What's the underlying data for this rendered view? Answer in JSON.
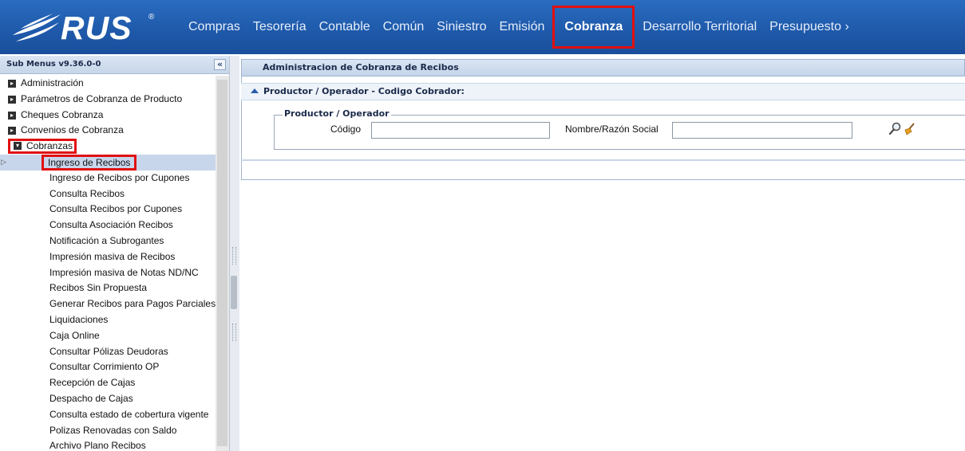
{
  "header": {
    "logo_text": "RUS",
    "logo_mark": "®",
    "nav": [
      {
        "label": "Compras"
      },
      {
        "label": "Tesorería"
      },
      {
        "label": "Contable"
      },
      {
        "label": "Común"
      },
      {
        "label": "Siniestro"
      },
      {
        "label": "Emisión"
      },
      {
        "label": "Cobranza"
      },
      {
        "label": "Desarrollo Territorial"
      },
      {
        "label": "Presupuesto ›"
      }
    ],
    "active_nav": "Cobranza"
  },
  "sidebar": {
    "title": "Sub Menus v9.36.0-0",
    "collapse_glyph": "«",
    "groups": [
      {
        "label": "Administración",
        "expanded": false
      },
      {
        "label": "Parámetros de Cobranza de Producto",
        "expanded": false
      },
      {
        "label": "Cheques Cobranza",
        "expanded": false
      },
      {
        "label": "Convenios de Cobranza",
        "expanded": false
      },
      {
        "label": "Cobranzas",
        "expanded": true
      }
    ],
    "children": [
      {
        "label": "Ingreso de Recibos",
        "selected": true
      },
      {
        "label": "Ingreso de Recibos por Cupones"
      },
      {
        "label": "Consulta Recibos"
      },
      {
        "label": "Consulta Recibos por Cupones"
      },
      {
        "label": "Consulta Asociación Recibos"
      },
      {
        "label": "Notificación a Subrogantes"
      },
      {
        "label": "Impresión masiva de Recibos"
      },
      {
        "label": "Impresión masiva de Notas ND/NC"
      },
      {
        "label": "Recibos Sin Propuesta"
      },
      {
        "label": "Generar Recibos para Pagos Parciales"
      },
      {
        "label": "Liquidaciones"
      },
      {
        "label": "Caja Online"
      },
      {
        "label": "Consultar Pólizas Deudoras"
      },
      {
        "label": "Consultar Corrimiento OP"
      },
      {
        "label": "Recepción de Cajas"
      },
      {
        "label": "Despacho de Cajas"
      },
      {
        "label": "Consulta estado de cobertura vigente"
      },
      {
        "label": "Polizas Renovadas con Saldo"
      },
      {
        "label": "Archivo Plano Recibos"
      }
    ]
  },
  "main": {
    "panel_title": "Administracion de Cobranza de Recibos",
    "section_title": "Productor / Operador - Codigo Cobrador:",
    "fieldset_legend": "Productor / Operador",
    "fields": {
      "codigo_label": "Código",
      "codigo_value": "",
      "nombre_label": "Nombre/Razón Social",
      "nombre_value": ""
    },
    "icons": [
      "search-icon",
      "clear-broom-icon"
    ]
  },
  "colors": {
    "topbar": "#1f5aab",
    "highlight": "#e01010",
    "panel_header": "#c4d4e9",
    "selected_row": "#c8d6ec"
  }
}
